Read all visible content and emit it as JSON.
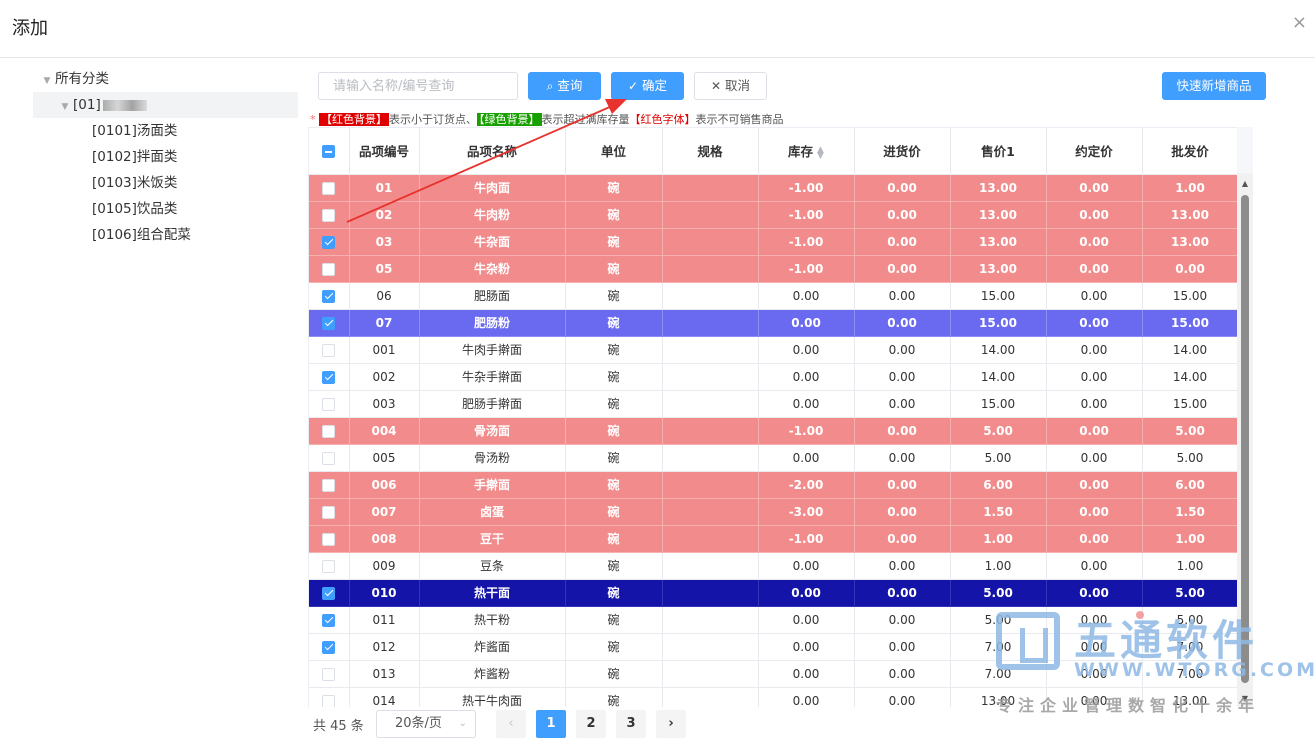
{
  "dialog": {
    "title": "添加",
    "close": "×"
  },
  "tree": {
    "root": "所有分类",
    "group": "[01]",
    "children": [
      "[0101]汤面类",
      "[0102]拌面类",
      "[0103]米饭类",
      "[0105]饮品类",
      "[0106]组合配菜"
    ]
  },
  "toolbar": {
    "search_placeholder": "请输入名称/编号查询",
    "search_btn": "查询",
    "confirm_btn": "确定",
    "cancel_btn": "取消",
    "quick_add_btn": "快速新增商品"
  },
  "legend": {
    "star": "*",
    "red_bg": "【红色背景】",
    "red_bg_desc": "表示小于订货点、",
    "green_bg": "【绿色背景】",
    "green_bg_desc": "表示超过满库存量",
    "red_font": "【红色字体】",
    "red_font_desc": "表示不可销售商品"
  },
  "table": {
    "headers": [
      "品项编号",
      "品项名称",
      "单位",
      "规格",
      "库存",
      "进货价",
      "售价1",
      "约定价",
      "批发价"
    ],
    "rows": [
      {
        "checked": false,
        "style": "red",
        "code": "01",
        "name": "牛肉面",
        "unit": "碗",
        "spec": "",
        "stock": "-1.00",
        "cost": "0.00",
        "price1": "13.00",
        "agreed": "0.00",
        "wholesale": "1.00"
      },
      {
        "checked": false,
        "style": "red",
        "code": "02",
        "name": "牛肉粉",
        "unit": "碗",
        "spec": "",
        "stock": "-1.00",
        "cost": "0.00",
        "price1": "13.00",
        "agreed": "0.00",
        "wholesale": "13.00"
      },
      {
        "checked": true,
        "style": "red",
        "code": "03",
        "name": "牛杂面",
        "unit": "碗",
        "spec": "",
        "stock": "-1.00",
        "cost": "0.00",
        "price1": "13.00",
        "agreed": "0.00",
        "wholesale": "13.00"
      },
      {
        "checked": false,
        "style": "red",
        "code": "05",
        "name": "牛杂粉",
        "unit": "碗",
        "spec": "",
        "stock": "-1.00",
        "cost": "0.00",
        "price1": "13.00",
        "agreed": "0.00",
        "wholesale": "0.00"
      },
      {
        "checked": true,
        "style": "normal",
        "code": "06",
        "name": "肥肠面",
        "unit": "碗",
        "spec": "",
        "stock": "0.00",
        "cost": "0.00",
        "price1": "15.00",
        "agreed": "0.00",
        "wholesale": "15.00"
      },
      {
        "checked": true,
        "style": "purple",
        "code": "07",
        "name": "肥肠粉",
        "unit": "碗",
        "spec": "",
        "stock": "0.00",
        "cost": "0.00",
        "price1": "15.00",
        "agreed": "0.00",
        "wholesale": "15.00"
      },
      {
        "checked": false,
        "style": "normal",
        "code": "001",
        "name": "牛肉手擀面",
        "unit": "碗",
        "spec": "",
        "stock": "0.00",
        "cost": "0.00",
        "price1": "14.00",
        "agreed": "0.00",
        "wholesale": "14.00"
      },
      {
        "checked": true,
        "style": "normal",
        "code": "002",
        "name": "牛杂手擀面",
        "unit": "碗",
        "spec": "",
        "stock": "0.00",
        "cost": "0.00",
        "price1": "14.00",
        "agreed": "0.00",
        "wholesale": "14.00"
      },
      {
        "checked": false,
        "style": "normal",
        "code": "003",
        "name": "肥肠手擀面",
        "unit": "碗",
        "spec": "",
        "stock": "0.00",
        "cost": "0.00",
        "price1": "15.00",
        "agreed": "0.00",
        "wholesale": "15.00"
      },
      {
        "checked": false,
        "style": "red",
        "code": "004",
        "name": "骨汤面",
        "unit": "碗",
        "spec": "",
        "stock": "-1.00",
        "cost": "0.00",
        "price1": "5.00",
        "agreed": "0.00",
        "wholesale": "5.00"
      },
      {
        "checked": false,
        "style": "normal",
        "code": "005",
        "name": "骨汤粉",
        "unit": "碗",
        "spec": "",
        "stock": "0.00",
        "cost": "0.00",
        "price1": "5.00",
        "agreed": "0.00",
        "wholesale": "5.00"
      },
      {
        "checked": false,
        "style": "red",
        "code": "006",
        "name": "手擀面",
        "unit": "碗",
        "spec": "",
        "stock": "-2.00",
        "cost": "0.00",
        "price1": "6.00",
        "agreed": "0.00",
        "wholesale": "6.00"
      },
      {
        "checked": false,
        "style": "red",
        "code": "007",
        "name": "卤蛋",
        "unit": "碗",
        "spec": "",
        "stock": "-3.00",
        "cost": "0.00",
        "price1": "1.50",
        "agreed": "0.00",
        "wholesale": "1.50"
      },
      {
        "checked": false,
        "style": "red",
        "code": "008",
        "name": "豆干",
        "unit": "碗",
        "spec": "",
        "stock": "-1.00",
        "cost": "0.00",
        "price1": "1.00",
        "agreed": "0.00",
        "wholesale": "1.00"
      },
      {
        "checked": false,
        "style": "normal",
        "code": "009",
        "name": "豆条",
        "unit": "碗",
        "spec": "",
        "stock": "0.00",
        "cost": "0.00",
        "price1": "1.00",
        "agreed": "0.00",
        "wholesale": "1.00"
      },
      {
        "checked": true,
        "style": "navy",
        "code": "010",
        "name": "热干面",
        "unit": "碗",
        "spec": "",
        "stock": "0.00",
        "cost": "0.00",
        "price1": "5.00",
        "agreed": "0.00",
        "wholesale": "5.00"
      },
      {
        "checked": true,
        "style": "normal",
        "code": "011",
        "name": "热干粉",
        "unit": "碗",
        "spec": "",
        "stock": "0.00",
        "cost": "0.00",
        "price1": "5.00",
        "agreed": "0.00",
        "wholesale": "5.00"
      },
      {
        "checked": true,
        "style": "normal",
        "code": "012",
        "name": "炸酱面",
        "unit": "碗",
        "spec": "",
        "stock": "0.00",
        "cost": "0.00",
        "price1": "7.00",
        "agreed": "0.00",
        "wholesale": "7.00"
      },
      {
        "checked": false,
        "style": "normal",
        "code": "013",
        "name": "炸酱粉",
        "unit": "碗",
        "spec": "",
        "stock": "0.00",
        "cost": "0.00",
        "price1": "7.00",
        "agreed": "0.00",
        "wholesale": "7.00"
      },
      {
        "checked": false,
        "style": "normal",
        "code": "014",
        "name": "热干牛肉面",
        "unit": "碗",
        "spec": "",
        "stock": "0.00",
        "cost": "0.00",
        "price1": "13.00",
        "agreed": "0.00",
        "wholesale": "13.00"
      }
    ]
  },
  "pager": {
    "total": "共 45 条",
    "page_size": "20条/页",
    "prev": "‹",
    "next": "›",
    "pages": [
      "1",
      "2",
      "3"
    ],
    "current": "1"
  },
  "watermark": {
    "brand": "五通软件",
    "url": "WWW.WTORG.COM",
    "slogan": "专注企业管理数智化十余年"
  },
  "colors": {
    "primary": "#409eff",
    "row_red": "#f28b8b",
    "row_purple": "#6a6af0",
    "row_navy": "#1414a8",
    "annotation_arrow": "#e8322e"
  }
}
